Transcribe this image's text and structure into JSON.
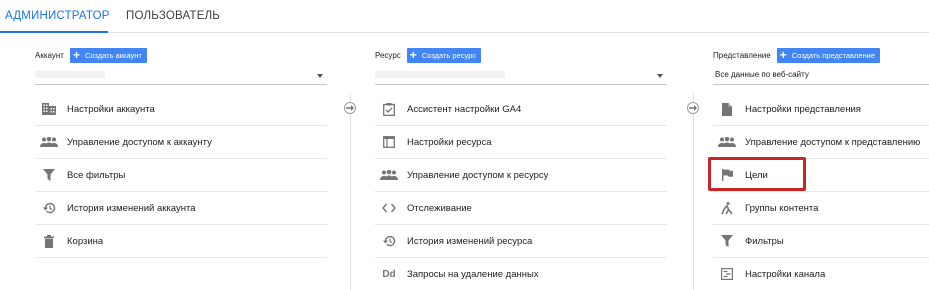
{
  "tabs": {
    "admin": "АДМИНИСТРАТОР",
    "user": "ПОЛЬЗОВАТЕЛЬ"
  },
  "account": {
    "label": "Аккаунт",
    "create": "Создать аккаунт",
    "items": [
      {
        "label": "Настройки аккаунта",
        "icon": "building-icon"
      },
      {
        "label": "Управление доступом к аккаунту",
        "icon": "people-icon"
      },
      {
        "label": "Все фильтры",
        "icon": "filter-icon"
      },
      {
        "label": "История изменений аккаунта",
        "icon": "history-icon"
      },
      {
        "label": "Корзина",
        "icon": "trash-icon"
      }
    ]
  },
  "property": {
    "label": "Ресурс",
    "create": "Создать ресурс",
    "items": [
      {
        "label": "Ассистент настройки GA4",
        "icon": "checklist-icon"
      },
      {
        "label": "Настройки ресурса",
        "icon": "window-icon"
      },
      {
        "label": "Управление доступом к ресурсу",
        "icon": "people-icon"
      },
      {
        "label": "Отслеживание",
        "icon": "code-icon"
      },
      {
        "label": "История изменений ресурса",
        "icon": "history-icon"
      },
      {
        "label": "Запросы на удаление данных",
        "icon": "dd-icon",
        "glyph": "Dd"
      }
    ]
  },
  "view": {
    "label": "Представление",
    "create": "Создать представление",
    "selected": "Все данные по веб-сайту",
    "items": [
      {
        "label": "Настройки представления",
        "icon": "document-icon"
      },
      {
        "label": "Управление доступом к представлению",
        "icon": "people-icon"
      },
      {
        "label": "Цели",
        "icon": "flag-icon"
      },
      {
        "label": "Группы контента",
        "icon": "walk-icon"
      },
      {
        "label": "Фильтры",
        "icon": "filter-icon"
      },
      {
        "label": "Настройки канала",
        "icon": "channel-icon"
      }
    ]
  },
  "colors": {
    "accent": "#1a73e8",
    "button": "#4285f4",
    "highlight": "#c62828",
    "icon": "#757575"
  }
}
